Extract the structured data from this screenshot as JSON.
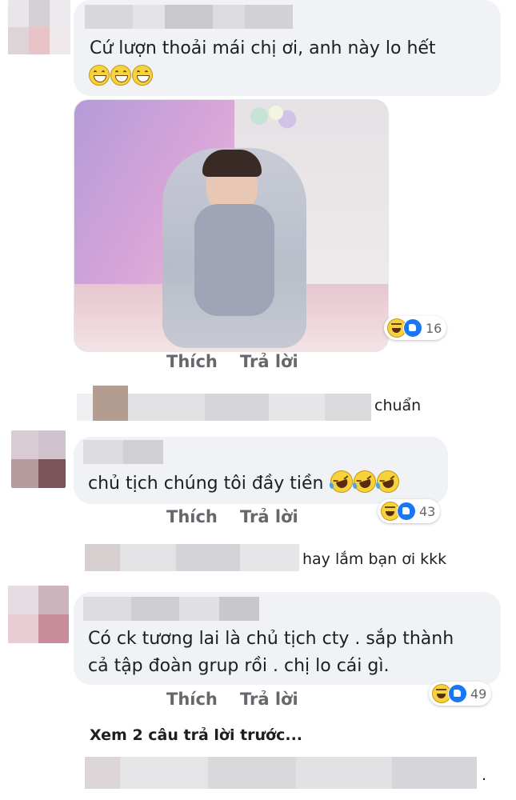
{
  "comments": [
    {
      "text": "Cứ lượn thoải mái chị ơi, anh này lo hết",
      "emoji": [
        "grin-emoji",
        "grin-emoji",
        "grin-emoji"
      ],
      "reactions_count": "16",
      "actions": {
        "like": "Thích",
        "reply": "Trả lời"
      }
    },
    {
      "text": "chủ tịch chúng tôi đầy tiền",
      "emoji": [
        "rofl-emoji",
        "rofl-emoji",
        "rofl-emoji"
      ],
      "reactions_count": "43",
      "actions": {
        "like": "Thích",
        "reply": "Trả lời"
      }
    },
    {
      "text_line1": "Có ck tương lai là chủ tịch cty . sắp thành",
      "text_line2": "cả tập đoàn grup rồi . chị lo cái gì.",
      "reactions_count": "49",
      "actions": {
        "like": "Thích",
        "reply": "Trả lời"
      }
    }
  ],
  "replies": [
    {
      "text": "chuẩn"
    },
    {
      "text": "hay lắm bạn ơi kkk"
    },
    {
      "text": "."
    }
  ],
  "view_more": "Xem 2 câu trả lời trước...",
  "colors": {
    "bubble": "#f0f2f5",
    "action_text": "#65676b",
    "like_blue": "#1877f2",
    "haha_yellow": "#f7d33b"
  }
}
